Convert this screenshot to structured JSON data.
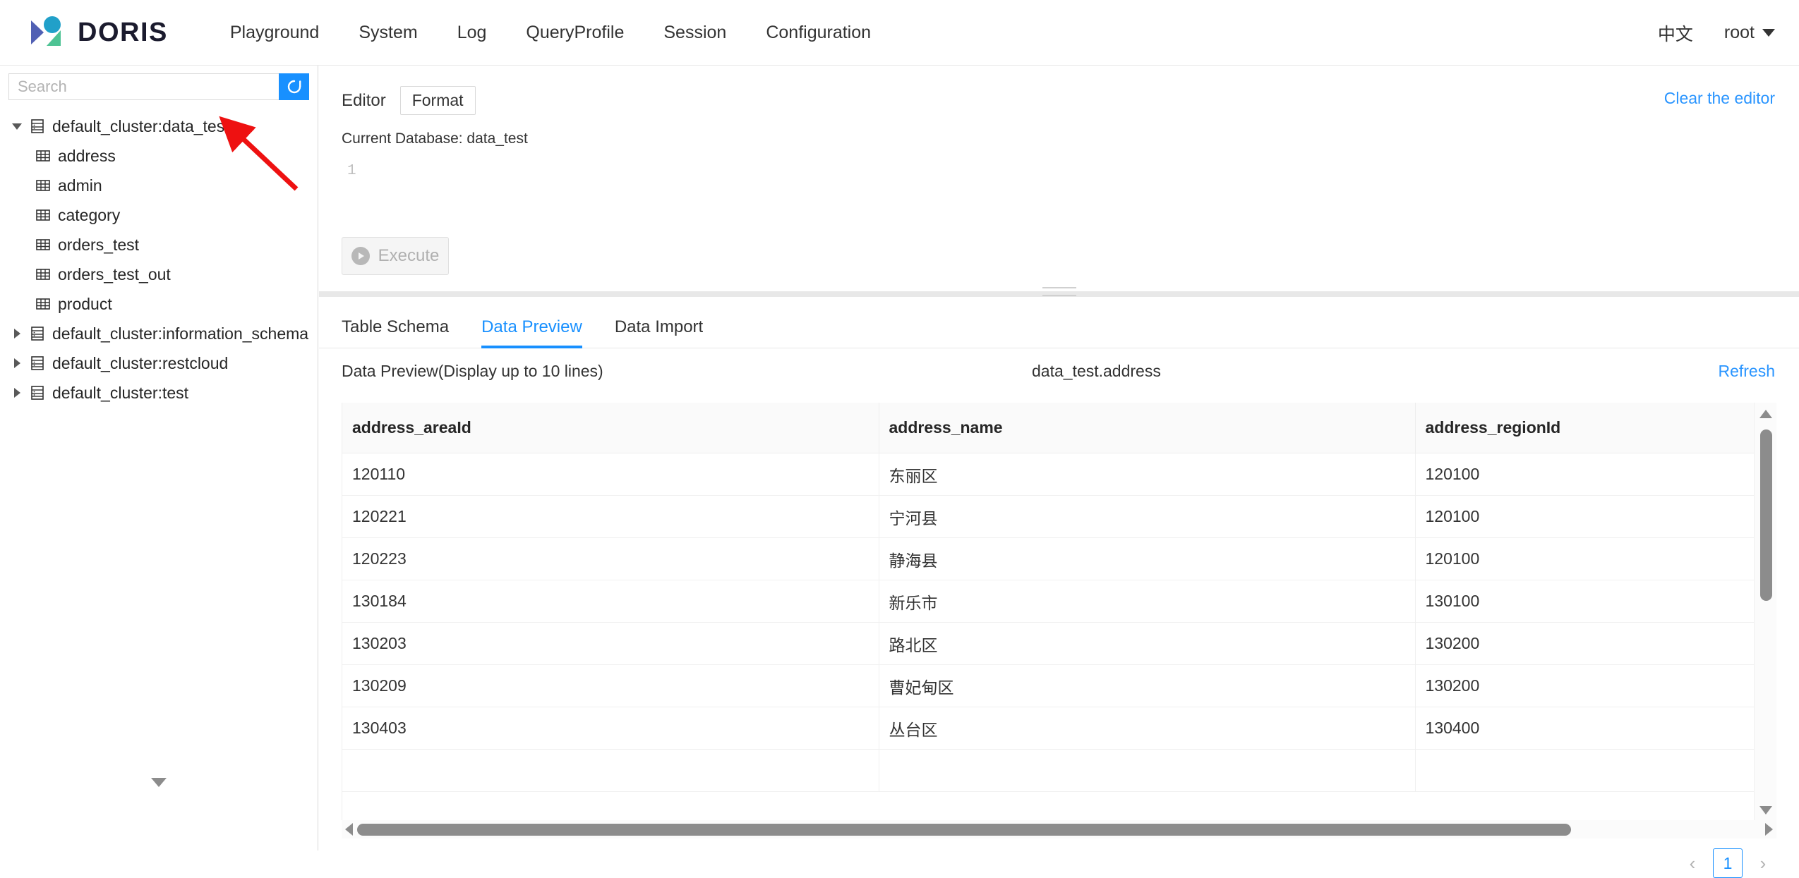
{
  "brand": {
    "name": "DORIS",
    "logo_icon": "doris-logo-icon"
  },
  "nav": {
    "items": [
      {
        "label": "Playground"
      },
      {
        "label": "System"
      },
      {
        "label": "Log"
      },
      {
        "label": "QueryProfile"
      },
      {
        "label": "Session"
      },
      {
        "label": "Configuration"
      }
    ],
    "lang_switch": "中文",
    "user": "root"
  },
  "sidebar": {
    "search": {
      "placeholder": "Search",
      "value": ""
    },
    "refresh_icon": "refresh-icon",
    "collapse_icon": "chevron-down-icon",
    "tree": [
      {
        "label": "default_cluster:data_test",
        "icon": "database-icon",
        "expanded": true,
        "level": 0
      },
      {
        "label": "address",
        "icon": "table-icon",
        "level": 1
      },
      {
        "label": "admin",
        "icon": "table-icon",
        "level": 1
      },
      {
        "label": "category",
        "icon": "table-icon",
        "level": 1
      },
      {
        "label": "orders_test",
        "icon": "table-icon",
        "level": 1
      },
      {
        "label": "orders_test_out",
        "icon": "table-icon",
        "level": 1
      },
      {
        "label": "product",
        "icon": "table-icon",
        "level": 1
      },
      {
        "label": "default_cluster:information_schema",
        "icon": "database-icon",
        "expanded": false,
        "level": 0
      },
      {
        "label": "default_cluster:restcloud",
        "icon": "database-icon",
        "expanded": false,
        "level": 0
      },
      {
        "label": "default_cluster:test",
        "icon": "database-icon",
        "expanded": false,
        "level": 0
      }
    ]
  },
  "editor": {
    "label": "Editor",
    "format_button": "Format",
    "clear_link": "Clear the editor",
    "current_database": "Current Database: data_test",
    "line_number": "1",
    "sql_value": "",
    "execute_button": "Execute",
    "execute_icon": "play-circle-icon"
  },
  "tabs": [
    {
      "label": "Table Schema",
      "active": false
    },
    {
      "label": "Data Preview",
      "active": true
    },
    {
      "label": "Data Import",
      "active": false
    }
  ],
  "preview": {
    "title": "Data Preview(Display up to 10 lines)",
    "table_name": "data_test.address",
    "refresh_link": "Refresh"
  },
  "table": {
    "columns": [
      "address_areaId",
      "address_name",
      "address_regionId"
    ],
    "rows": [
      [
        "120110",
        "东丽区",
        "120100"
      ],
      [
        "120221",
        "宁河县",
        "120100"
      ],
      [
        "120223",
        "静海县",
        "120100"
      ],
      [
        "130184",
        "新乐市",
        "130100"
      ],
      [
        "130203",
        "路北区",
        "130200"
      ],
      [
        "130209",
        "曹妃甸区",
        "130200"
      ],
      [
        "130403",
        "丛台区",
        "130400"
      ],
      [
        "",
        "",
        ""
      ]
    ]
  },
  "pagination": {
    "prev": "‹",
    "current": "1",
    "next": "›"
  },
  "colors": {
    "accent": "#1890ff",
    "link": "#2a95ff",
    "annotation": "#ee1111",
    "logo_blue": "#21a0c9",
    "logo_purple": "#5160b4",
    "logo_green": "#4ec394"
  }
}
